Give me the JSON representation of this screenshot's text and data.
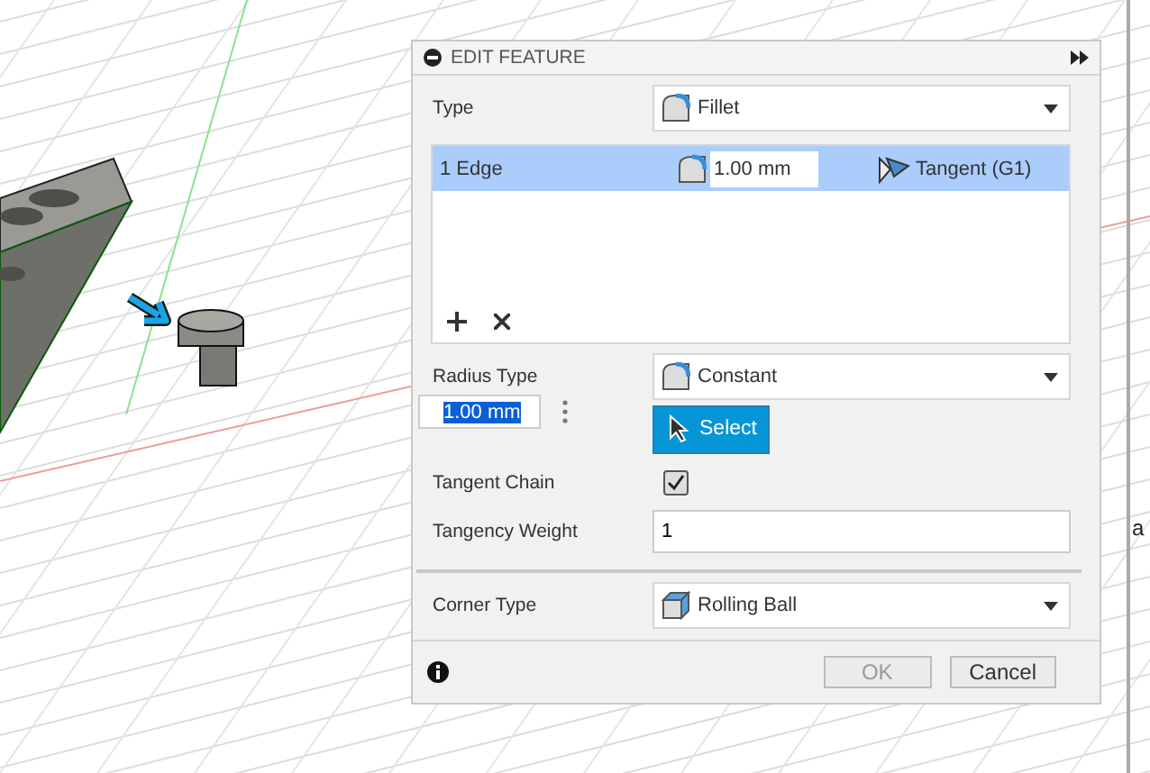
{
  "dialog": {
    "title": "EDIT FEATURE",
    "collapsed": false,
    "type": {
      "label": "Type",
      "value": "Fillet"
    },
    "edge_list": {
      "rows": [
        {
          "label": "1 Edge",
          "radius": "1.00 mm",
          "continuity": "Tangent (G1)",
          "selected": true
        }
      ]
    },
    "radius_type": {
      "label": "Radius Type",
      "value": "Constant"
    },
    "select_button": "Select",
    "tangent_chain": {
      "label": "Tangent Chain",
      "checked": true
    },
    "tangency_weight": {
      "label": "Tangency Weight",
      "value": "1"
    },
    "corner_type": {
      "label": "Corner Type",
      "value": "Rolling Ball"
    },
    "buttons": [
      {
        "label": "OK",
        "disabled": true
      },
      {
        "label": "Cancel",
        "disabled": false
      }
    ]
  },
  "floating_input": {
    "value": "1.00 mm"
  },
  "edge_text": "a"
}
